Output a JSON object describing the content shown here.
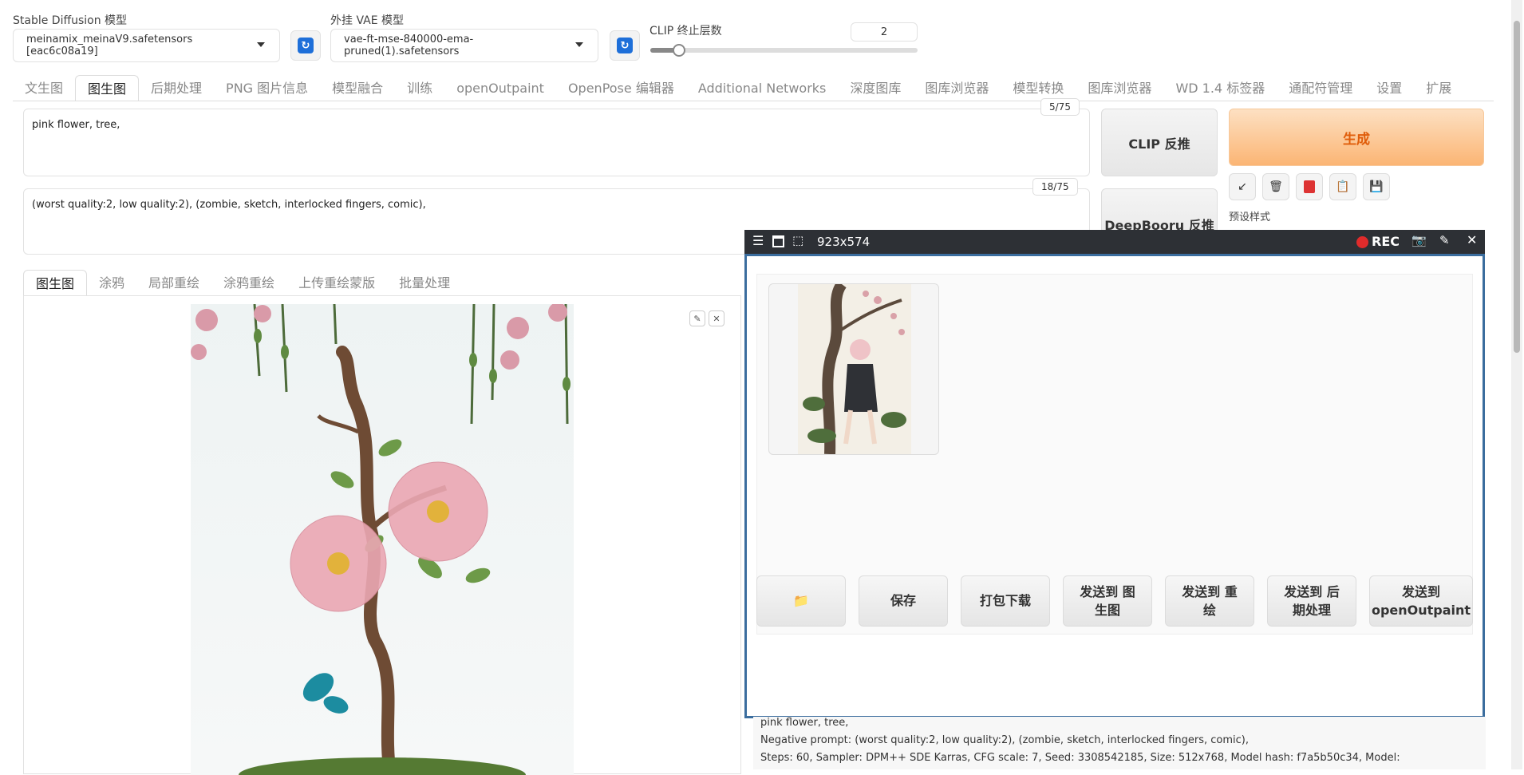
{
  "models": {
    "sd_label": "Stable Diffusion 模型",
    "sd_value": "meinamix_meinaV9.safetensors [eac6c08a19]",
    "vae_label": "外挂 VAE 模型",
    "vae_value": "vae-ft-mse-840000-ema-pruned(1).safetensors",
    "clip_label": "CLIP 终止层数",
    "clip_value": "2",
    "clip_slider": {
      "min": 1,
      "max": 12,
      "value": 2
    }
  },
  "tabs": [
    "文生图",
    "图生图",
    "后期处理",
    "PNG 图片信息",
    "模型融合",
    "训练",
    "openOutpaint",
    "OpenPose 编辑器",
    "Additional Networks",
    "深度图库",
    "图库浏览器",
    "模型转换",
    "图库浏览器",
    "WD 1.4 标签器",
    "通配符管理",
    "设置",
    "扩展"
  ],
  "active_tab": "图生图",
  "prompt": {
    "text": "pink flower, tree,",
    "counter": "5/75"
  },
  "negative_prompt": {
    "text": "(worst quality:2, low quality:2), (zombie, sketch, interlocked fingers, comic),",
    "counter": "18/75"
  },
  "buttons": {
    "clip_interrogate": "CLIP 反推",
    "deepbooru": "DeepBooru 反推",
    "generate": "生成",
    "preset_label": "预设样式"
  },
  "tool_icons": [
    "arrow-icon",
    "trash-icon",
    "card-icon",
    "clipboard-icon",
    "save-icon"
  ],
  "sub_tabs": [
    "图生图",
    "涂鸦",
    "局部重绘",
    "涂鸦重绘",
    "上传重绘蒙版",
    "批量处理"
  ],
  "active_sub_tab": "图生图",
  "overlay": {
    "title": "923x574",
    "rec_label": "REC"
  },
  "output_buttons": {
    "folder": "📁",
    "save": "保存",
    "zip": "打包下载",
    "send_img2img": "发送到 图生图",
    "send_inpaint": "发送到 重绘",
    "send_extras": "发送到 后期处理",
    "send_outpaint": "发送到 openOutpaint"
  },
  "gen_info": {
    "prompt": "pink flower, tree,",
    "negative": "Negative prompt: (worst quality:2, low quality:2), (zombie, sketch, interlocked fingers, comic),",
    "params": "Steps: 60, Sampler: DPM++ SDE Karras, CFG scale: 7, Seed: 3308542185, Size: 512x768, Model hash: f7a5b50c34, Model:"
  },
  "colors": {
    "generate_text": "#e05d0a",
    "accent_blue": "#1e6fd9",
    "overlay_border": "#3b6d9e",
    "rec_red": "#e02b2b"
  }
}
